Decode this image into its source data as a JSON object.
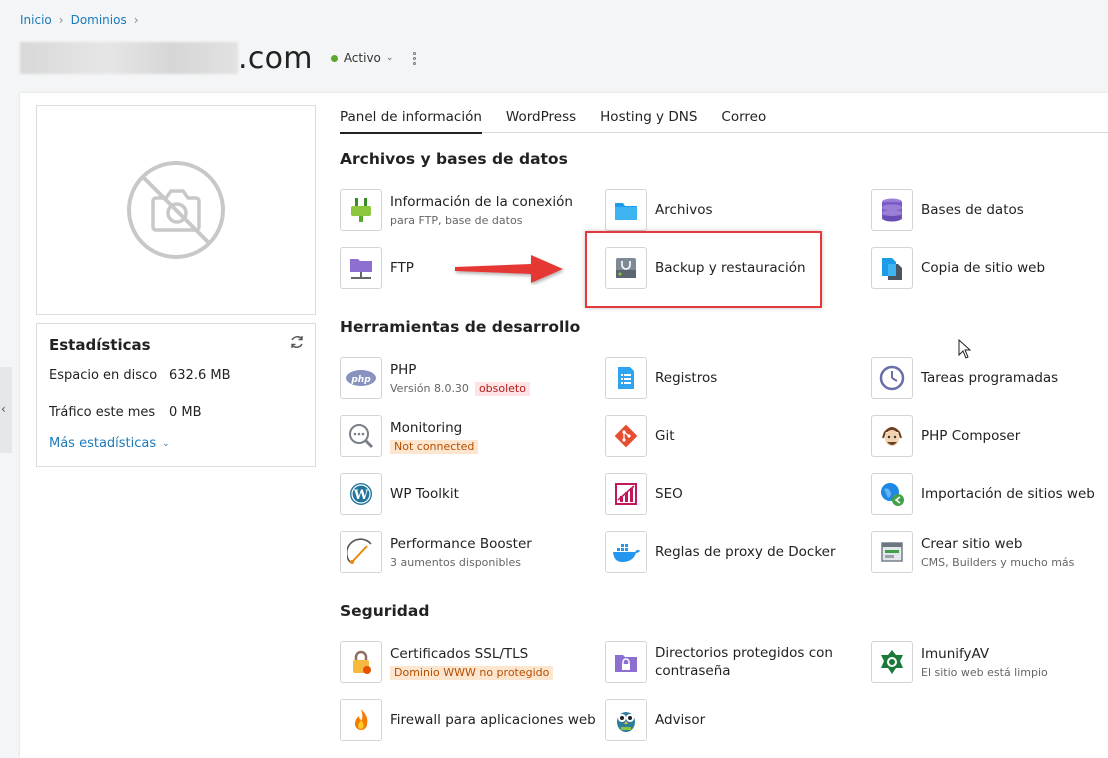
{
  "breadcrumb": {
    "items": [
      "Inicio",
      "Dominios"
    ]
  },
  "domain": {
    "tld": ".com",
    "status": "Activo"
  },
  "stats": {
    "title": "Estadísticas",
    "disk_label": "Espacio en disco",
    "disk_value": "632.6 MB",
    "traffic_label": "Tráfico este mes",
    "traffic_value": "0 MB",
    "more": "Más estadísticas"
  },
  "tabs": [
    "Panel de información",
    "WordPress",
    "Hosting y DNS",
    "Correo"
  ],
  "sections": {
    "files": {
      "title": "Archivos y bases de datos",
      "conn": {
        "name": "Información de la conexión",
        "sub": "para FTP, base de datos"
      },
      "archivos": {
        "name": "Archivos"
      },
      "db": {
        "name": "Bases de datos"
      },
      "ftp": {
        "name": "FTP"
      },
      "backup": {
        "name": "Backup y restauración"
      },
      "copy": {
        "name": "Copia de sitio web"
      }
    },
    "dev": {
      "title": "Herramientas de desarrollo",
      "php": {
        "name": "PHP",
        "sub": "Versión 8.0.30",
        "badge": "obsoleto"
      },
      "logs": {
        "name": "Registros"
      },
      "cron": {
        "name": "Tareas programadas"
      },
      "monitoring": {
        "name": "Monitoring",
        "badge": "Not connected"
      },
      "git": {
        "name": "Git"
      },
      "composer": {
        "name": "PHP Composer"
      },
      "wptoolkit": {
        "name": "WP Toolkit"
      },
      "seo": {
        "name": "SEO"
      },
      "import": {
        "name": "Importación de sitios web"
      },
      "perf": {
        "name": "Performance Booster",
        "sub": "3 aumentos disponibles"
      },
      "docker": {
        "name": "Reglas de proxy de Docker"
      },
      "create": {
        "name": "Crear sitio web",
        "sub": "CMS, Builders y mucho más"
      }
    },
    "security": {
      "title": "Seguridad",
      "ssl": {
        "name": "Certificados SSL/TLS",
        "badge": "Dominio WWW no protegido"
      },
      "dirs": {
        "name1": "Directorios protegidos con",
        "name2": "contraseña"
      },
      "imunify": {
        "name": "ImunifyAV",
        "sub": "El sitio web está limpio"
      },
      "firewall": {
        "name": "Firewall para aplicaciones web"
      },
      "advisor": {
        "name": "Advisor"
      }
    }
  },
  "colors": {
    "accent": "#1b7ab8",
    "active_dot": "#5aa82d",
    "highlight": "#e33b3b"
  }
}
